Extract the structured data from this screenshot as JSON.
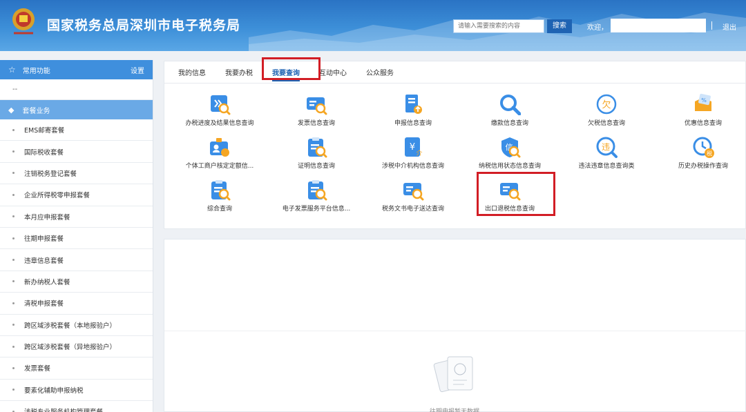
{
  "header": {
    "title": "国家税务总局深圳市电子税务局",
    "search_placeholder": "请输入需要搜索的内容",
    "search_label": "搜索",
    "welcome": "欢迎，",
    "logout": "退出"
  },
  "sidebar": {
    "header": "常用功能",
    "settings": "设置",
    "dash": "--",
    "group": "套餐业务",
    "items": [
      "EMS邮寄套餐",
      "国际税收套餐",
      "注销税务登记套餐",
      "企业所得税零申报套餐",
      "本月应申报套餐",
      "往期申报套餐",
      "违章信息套餐",
      "新办纳税人套餐",
      "清税申报套餐",
      "跨区域涉税套餐（本地报验户）",
      "跨区域涉税套餐（异地报验户）",
      "发票套餐",
      "要素化辅助申报纳税",
      "涉税专业服务机构管理套餐"
    ]
  },
  "tabs": [
    "我的信息",
    "我要办税",
    "我要查询",
    "互动中心",
    "公众服务"
  ],
  "active_tab": "我要查询",
  "services": [
    {
      "label": "办税进度及结果信息查询",
      "icon": "progress-query-icon"
    },
    {
      "label": "发票信息查询",
      "icon": "invoice-query-icon"
    },
    {
      "label": "申报信息查询",
      "icon": "declaration-query-icon"
    },
    {
      "label": "缴款信息查询",
      "icon": "payment-query-icon"
    },
    {
      "label": "欠税信息查询",
      "icon": "arrears-query-icon"
    },
    {
      "label": "优惠信息查询",
      "icon": "discount-query-icon"
    },
    {
      "label": "个体工商户核定定额信...",
      "icon": "individual-business-icon"
    },
    {
      "label": "证明信息查询",
      "icon": "certificate-query-icon"
    },
    {
      "label": "涉税中介机构信息查询",
      "icon": "agency-query-icon"
    },
    {
      "label": "纳税信用状态信息查询",
      "icon": "credit-query-icon"
    },
    {
      "label": "违法违章信息查询类",
      "icon": "violation-query-icon"
    },
    {
      "label": "历史办税操作查询",
      "icon": "history-query-icon"
    },
    {
      "label": "综合查询",
      "icon": "comprehensive-query-icon"
    },
    {
      "label": "电子发票服务平台信息...",
      "icon": "e-invoice-platform-icon"
    },
    {
      "label": "税务文书电子送达查询",
      "icon": "document-delivery-icon"
    },
    {
      "label": "出口退税信息查询",
      "icon": "export-refund-query-icon"
    }
  ],
  "highlighted_service": "出口退税信息查询",
  "empty_state": "往期申报暂无数据",
  "colors": {
    "header_blue": "#2a73c4",
    "sidebar_active": "#3f8fdd",
    "highlight_red": "#d21d25",
    "icon_blue": "#3a8ee6",
    "icon_orange": "#f5a623"
  }
}
